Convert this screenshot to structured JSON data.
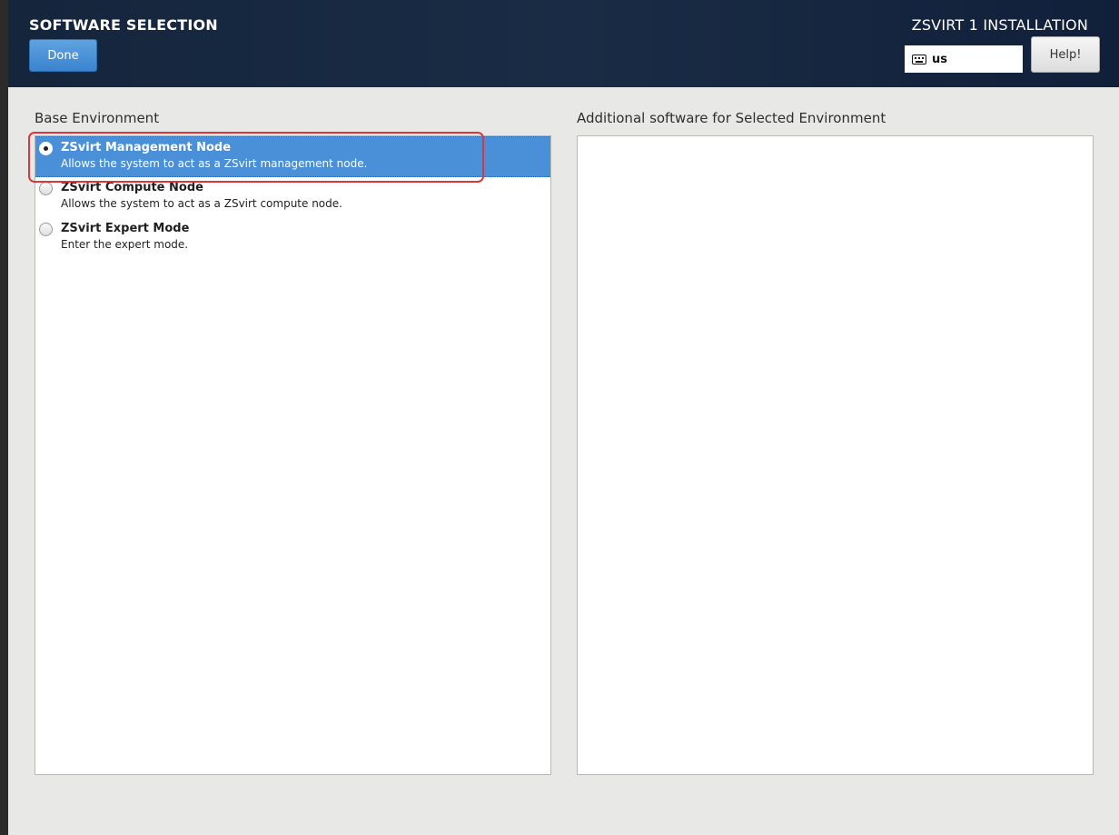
{
  "header": {
    "title": "SOFTWARE SELECTION",
    "done_label": "Done",
    "install_title": "ZSVIRT 1 INSTALLATION",
    "keyboard_layout": "us",
    "keyboard_icon": "keyboard-icon",
    "help_label": "Help!"
  },
  "base_environment": {
    "label": "Base Environment",
    "items": [
      {
        "name": "ZSvirt Management Node",
        "description": "Allows the system to act as a ZSvirt management node.",
        "selected": true
      },
      {
        "name": "ZSvirt Compute Node",
        "description": "Allows the system to act as a ZSvirt compute node.",
        "selected": false
      },
      {
        "name": "ZSvirt Expert Mode",
        "description": "Enter the expert mode.",
        "selected": false
      }
    ]
  },
  "additional_software": {
    "label": "Additional software for Selected Environment",
    "items": []
  },
  "colors": {
    "header_bg": "#14253c",
    "selection_blue": "#4a90d9",
    "done_blue": "#4a94da",
    "annotation_red": "#d9363e"
  }
}
